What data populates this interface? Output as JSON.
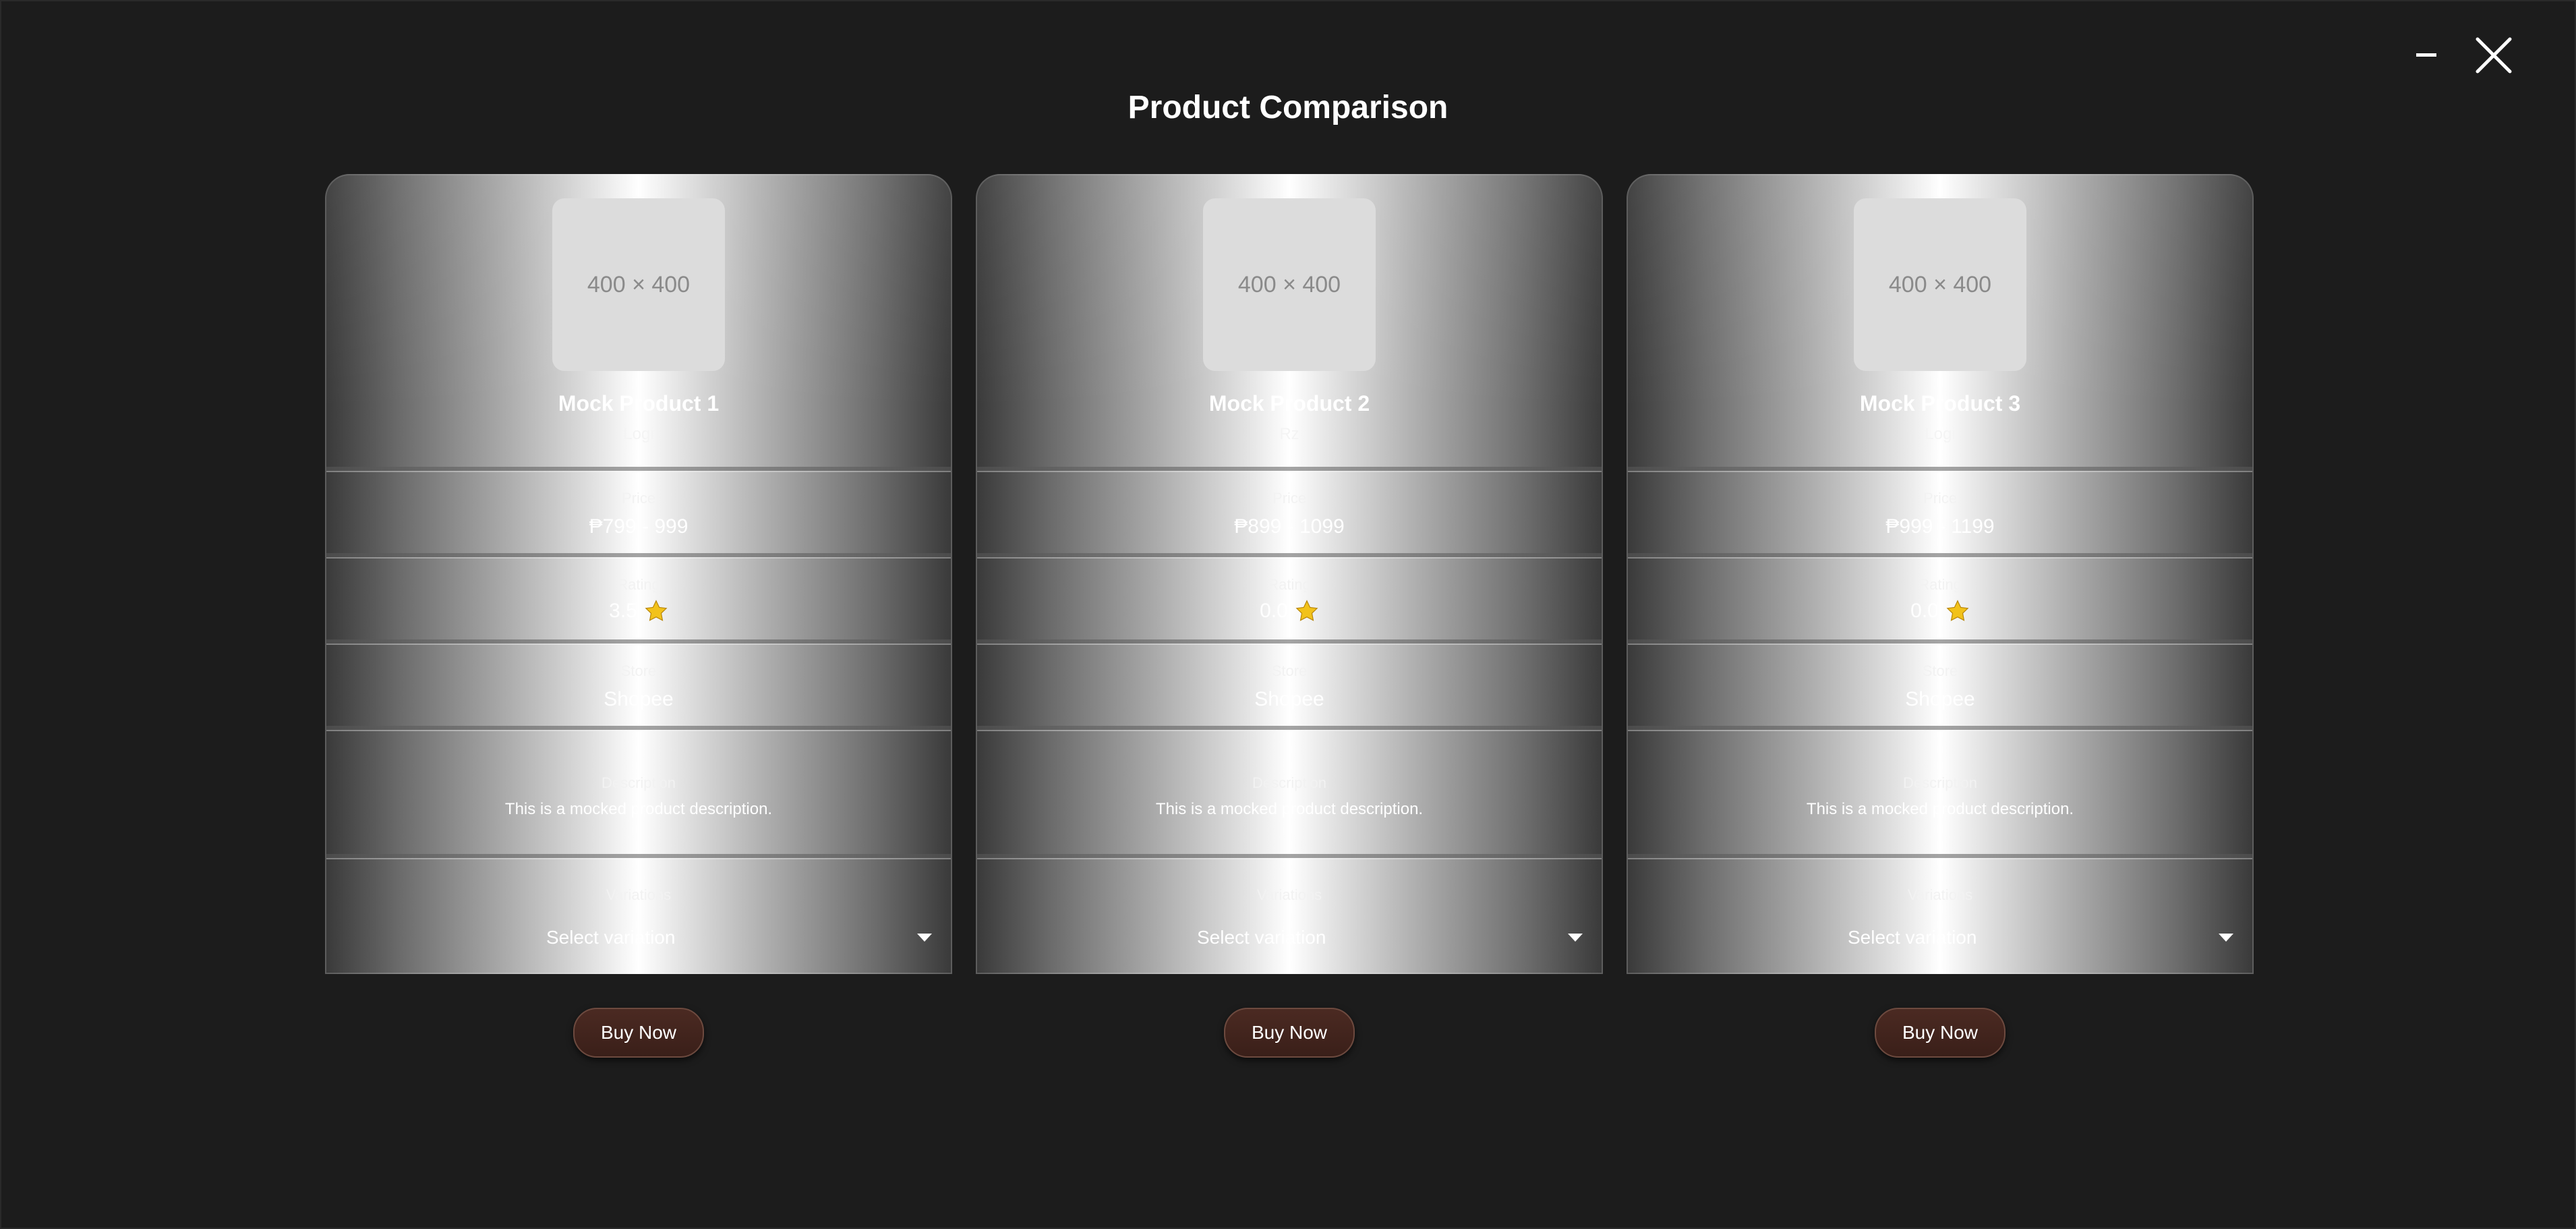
{
  "window": {
    "minimize_icon": "minimize-icon",
    "close_icon": "close-icon"
  },
  "page_title": "Product Comparison",
  "labels": {
    "price": "Price",
    "rating": "Rating",
    "store": "Store",
    "description": "Description",
    "variations": "Variations",
    "buy_now": "Buy Now"
  },
  "products": [
    {
      "image_placeholder": "400 × 400",
      "name": "Mock Product 1",
      "brand": "Logi",
      "price": "₱799 - 999",
      "rating": "3.5",
      "store": "Shopee",
      "description": "This is a mocked product description.",
      "variation_placeholder": "Select variation"
    },
    {
      "image_placeholder": "400 × 400",
      "name": "Mock Product 2",
      "brand": "Rz",
      "price": "₱899 - 1099",
      "rating": "0.0",
      "store": "Shopee",
      "description": "This is a mocked product description.",
      "variation_placeholder": "Select variation"
    },
    {
      "image_placeholder": "400 × 400",
      "name": "Mock Product 3",
      "brand": "Logi",
      "price": "₱999 - 1199",
      "rating": "0.0",
      "store": "Shopee",
      "description": "This is a mocked product description.",
      "variation_placeholder": "Select variation"
    }
  ],
  "colors": {
    "background": "#1c1c1c",
    "star": "#f2c21a",
    "buy_button": "#3f221c"
  }
}
